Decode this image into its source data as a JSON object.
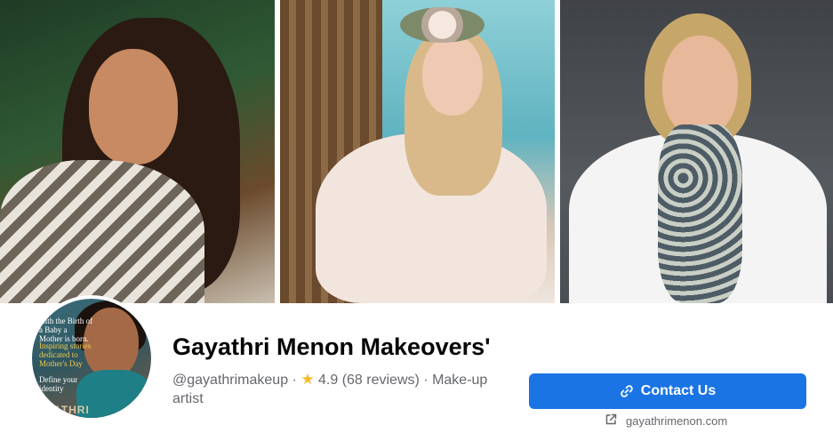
{
  "profile": {
    "name": "Gayathri Menon Makeovers'",
    "handle": "@gayathrimakeup",
    "separator": " · ",
    "rating_icon": "star-icon",
    "rating": "4.9 (68 reviews)",
    "category": "Make-up artist"
  },
  "avatar": {
    "cover_line1": "...ith the Birth of a Baby a Mother is born.",
    "cover_line2": "Inspiring stories dedicated to Mother's Day",
    "cover_line3": "Define your identity",
    "cover_brand": "ATHRI"
  },
  "actions": {
    "contact_label": "Contact Us",
    "contact_icon": "link-icon",
    "website_icon": "external-link-icon",
    "website": "gayathrimenon.com"
  },
  "colors": {
    "primary": "#1b74e4",
    "secondary_text": "#65676b",
    "star": "#f7b928"
  }
}
